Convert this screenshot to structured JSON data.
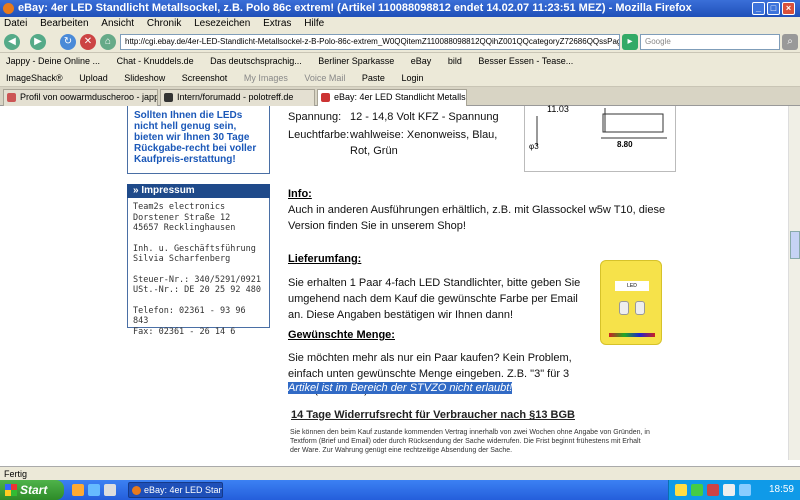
{
  "window": {
    "title": "eBay: 4er LED Standlicht Metallsockel, z.B. Polo 86c extrem! (Artikel 110088098812 endet 14.02.07 11:23:51 MEZ) - Mozilla Firefox"
  },
  "menu": [
    "Datei",
    "Bearbeiten",
    "Ansicht",
    "Chronik",
    "Lesezeichen",
    "Extras",
    "Hilfe"
  ],
  "nav": {
    "url": "http://cgi.ebay.de/4er-LED-Standlicht-Metallsockel-z-B-Polo-86c-extrem_W0QQitemZ110088098812QQihZ001QQcategoryZ72686QQssPageNameZWD",
    "search_placeholder": "Google"
  },
  "bookmarks1": [
    "Jappy - Deine Online ...",
    "Chat - Knuddels.de",
    "Das deutschsprachig...",
    "Berliner Sparkasse",
    "eBay",
    "bild",
    "Besser Essen - Tease..."
  ],
  "bookmarks2": [
    "ImageShack®",
    "Upload",
    "Slideshow",
    "Screenshot",
    "My Images",
    "Voice Mail",
    "Paste",
    "Login"
  ],
  "tabs": [
    "Profil von oowarmduscheroo - jappy.de",
    "Intern/forumadd - polotreff.de",
    "eBay: 4er LED Standlicht Metallso..."
  ],
  "sidebar": {
    "promo": "Sollten Ihnen die LEDs nicht hell genug sein, bieten wir Ihnen 30 Tage Rückgabe-recht bei voller Kaufpreis-erstattung!",
    "impressum_header": "» Impressum",
    "impressum_lines": [
      "Team2s electronics",
      "Dorstener Straße 12",
      "45657 Recklinghausen",
      "",
      "Inh. u. Geschäftsführung",
      "Silvia Scharfenberg",
      "",
      "Steuer-Nr.: 340/5291/0921",
      "USt.-Nr.: DE 20 25 92 480",
      "",
      "Telefon: 02361 - 93 96 843",
      "Fax: 02361 - 26 14 6"
    ]
  },
  "specs": [
    {
      "label": "Spannung:",
      "value": "12 - 14,8 Volt KFZ - Spannung"
    },
    {
      "label": "Leuchtfarbe:",
      "value": "wahlweise: Xenonweiss, Blau, Rot, Grün"
    }
  ],
  "diagram": {
    "dim1": "11.03",
    "dim2": "8.80",
    "dim3": "φ3"
  },
  "info": {
    "heading": "Info:",
    "text": "Auch in anderen Ausführungen erhältlich, z.B. mit Glassockel w5w T10, diese Version finden Sie in unserem Shop!"
  },
  "lieferumfang": {
    "heading": "Lieferumfang:",
    "text": "Sie erhalten 1 Paar 4-fach LED Standlichter, bitte geben Sie umgehend nach dem Kauf die gewünschte Farbe per Email an. Diese Angaben bestätigen wir Ihnen dann!"
  },
  "menge": {
    "heading": "Gewünschte Menge:",
    "text": "Sie möchten mehr als nur ein Paar kaufen? Kein Problem, einfach unten gewünschte Menge eingeben. Z.B. \"3\" für 3 Paar (= 6 Stück)",
    "selected": "Artikel ist im Bereich der STVZO nicht erlaubt!"
  },
  "widerruf": {
    "heading": "14 Tage Widerrufsrecht für Verbraucher nach §13 BGB",
    "text": "Sie können den beim Kauf zustande kommenden Vertrag innerhalb von zwei Wochen ohne Angabe von Gründen, in Textform (Brief und Email) oder durch Rücksendung der Sache widerrufen. Die Frist beginnt frühestens mit Erhalt der Ware. Zur Wahrung genügt eine rechtzeitige Absendung der Sache."
  },
  "status": "Fertig",
  "taskbar": {
    "start": "Start",
    "task": "eBay: 4er LED Standl...",
    "clock": "18:59"
  },
  "colors": {
    "titlebar": "#245edb",
    "link_blue": "#1a57b8",
    "selection": "#316ac5"
  }
}
